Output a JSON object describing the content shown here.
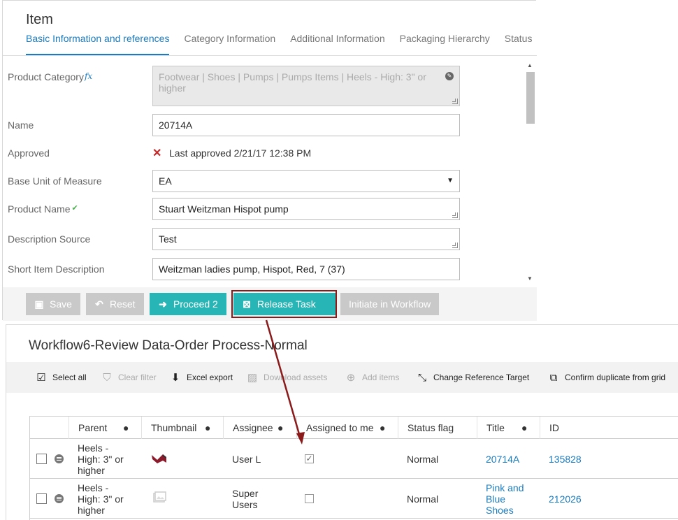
{
  "item": {
    "title": "Item",
    "tabs": [
      "Basic Information and references",
      "Category Information",
      "Additional Information",
      "Packaging Hierarchy",
      "Status"
    ],
    "fields": {
      "product_category": {
        "label": "Product Category",
        "value": "Footwear | Shoes | Pumps | Pumps Items | Heels - High: 3\" or higher",
        "fx": "fx"
      },
      "name": {
        "label": "Name",
        "value": "20714A"
      },
      "approved": {
        "label": "Approved",
        "value": "Last approved 2/21/17 12:38 PM"
      },
      "base_uom": {
        "label": "Base Unit of Measure",
        "value": "EA"
      },
      "product_name": {
        "label": "Product Name",
        "value": "Stuart Weitzman Hispot pump"
      },
      "description_source": {
        "label": "Description Source",
        "value": "Test"
      },
      "short_item_description": {
        "label": "Short Item Description",
        "value": "Weitzman ladies pump, Hispot, Red, 7 (37)"
      }
    },
    "buttons": {
      "save": "Save",
      "reset": "Reset",
      "proceed": "Proceed 2",
      "release_task": "Release Task",
      "initiate": "Initiate in Workflow"
    }
  },
  "workflow": {
    "title": "Workflow6-Review Data-Order Process-Normal",
    "toolbar": {
      "select_all": "Select all",
      "clear_filter": "Clear filter",
      "excel_export": "Excel export",
      "download_assets": "Download assets",
      "add_items": "Add items",
      "change_reference_target": "Change Reference Target",
      "confirm_duplicate": "Confirm duplicate from grid"
    },
    "columns": [
      "Parent",
      "Thumbnail",
      "Assignee",
      "Assigned to me",
      "Status flag",
      "Title",
      "ID"
    ],
    "rows": [
      {
        "parent": "Heels - High: 3\" or higher",
        "assignee": "User L",
        "assigned_to_me": true,
        "status_flag": "Normal",
        "title": "20714A",
        "id": "135828"
      },
      {
        "parent": "Heels - High: 3\" or higher",
        "assignee": "Super Users",
        "assigned_to_me": false,
        "status_flag": "Normal",
        "title": "Pink and Blue Shoes",
        "id": "212026"
      }
    ]
  },
  "colors": {
    "accent": "#1a7bbf",
    "teal": "#28b5b5",
    "highlight": "#8b1a1a",
    "error": "#c62828"
  }
}
